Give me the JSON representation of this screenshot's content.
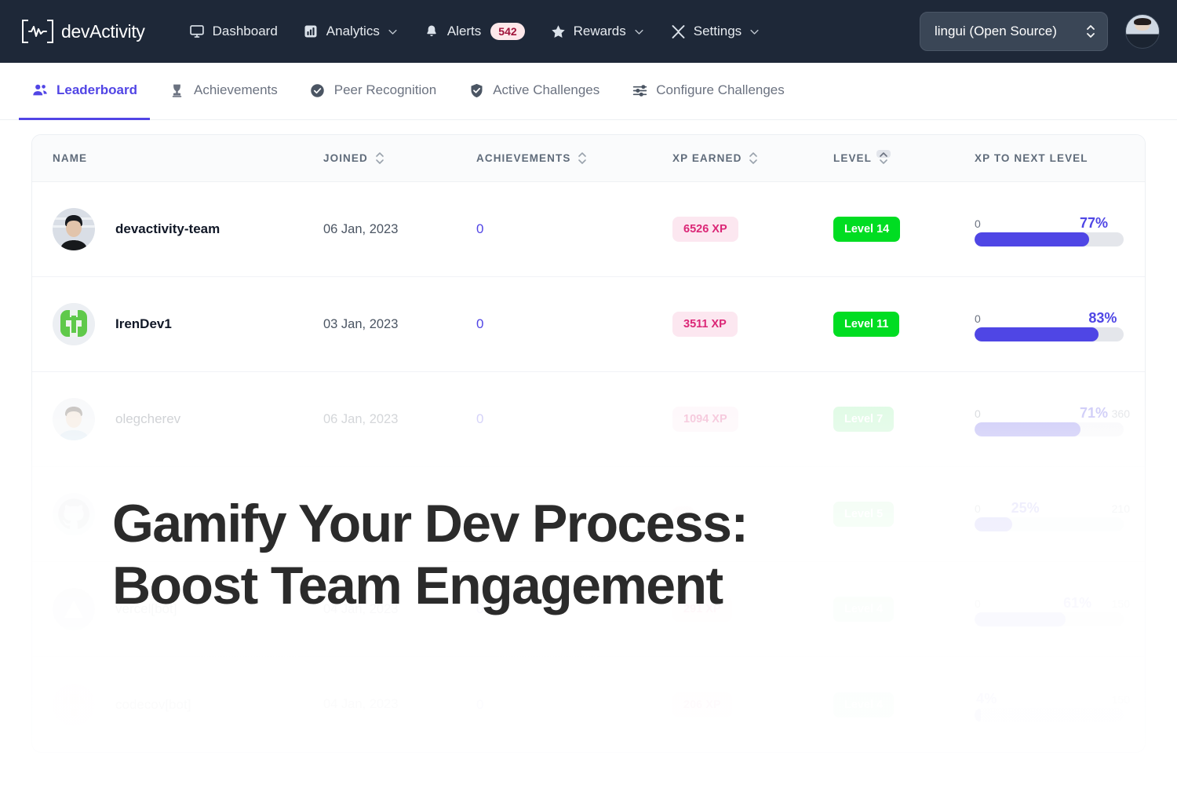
{
  "navbar": {
    "brand": "devActivity",
    "brand_icon": "waveform-bracket-logo",
    "items": [
      {
        "label": "Dashboard",
        "icon": "monitor-icon",
        "has_caret": false,
        "badge": null
      },
      {
        "label": "Analytics",
        "icon": "bar-chart-icon",
        "has_caret": true,
        "badge": null
      },
      {
        "label": "Alerts",
        "icon": "bell-icon",
        "has_caret": false,
        "badge": "542"
      },
      {
        "label": "Rewards",
        "icon": "star-icon",
        "has_caret": true,
        "badge": null
      },
      {
        "label": "Settings",
        "icon": "wrench-screwdriver-icon",
        "has_caret": true,
        "badge": null
      }
    ],
    "repo_select": {
      "value": "lingui (Open Source)",
      "icon": "up-down-chevron-icon"
    },
    "avatar": "user-avatar"
  },
  "tabs": [
    {
      "label": "Leaderboard",
      "icon": "people-icon",
      "active": true
    },
    {
      "label": "Achievements",
      "icon": "trophy-icon",
      "active": false
    },
    {
      "label": "Peer Recognition",
      "icon": "check-shield-icon",
      "active": false
    },
    {
      "label": "Active Challenges",
      "icon": "shield-check-icon",
      "active": false
    },
    {
      "label": "Configure Challenges",
      "icon": "sliders-icon",
      "active": false
    }
  ],
  "table": {
    "columns": [
      {
        "label": "NAME",
        "sortable": false
      },
      {
        "label": "JOINED",
        "sortable": true
      },
      {
        "label": "ACHIEVEMENTS",
        "sortable": true
      },
      {
        "label": "XP EARNED",
        "sortable": true
      },
      {
        "label": "LEVEL",
        "sortable": true,
        "sort_hover": "asc"
      },
      {
        "label": "XP TO NEXT LEVEL",
        "sortable": false
      }
    ],
    "rows": [
      {
        "name": "devactivity-team",
        "avatar": "photo-avatar-dark",
        "joined": "06 Jan, 2023",
        "achievements": "0",
        "xp_earned": "6526 XP",
        "level": "Level 14",
        "progress": {
          "min": "0",
          "max": "",
          "percent_label": "77%",
          "percent": 77
        },
        "fade": 0
      },
      {
        "name": "IrenDev1",
        "avatar": "green-square-logo",
        "joined": "03 Jan, 2023",
        "achievements": "0",
        "xp_earned": "3511 XP",
        "level": "Level 11",
        "progress": {
          "min": "0",
          "max": "",
          "percent_label": "83%",
          "percent": 83
        },
        "fade": 0
      },
      {
        "name": "olegcherev",
        "avatar": "photo-avatar-light",
        "joined": "06 Jan, 2023",
        "achievements": "0",
        "xp_earned": "1094 XP",
        "level": "Level 7",
        "progress": {
          "min": "0",
          "max": "360",
          "percent_label": "71%",
          "percent": 71
        },
        "fade": 1
      },
      {
        "name": "",
        "avatar": "github-icon",
        "joined": "",
        "achievements": "",
        "xp_earned": "",
        "level": "Level 5",
        "progress": {
          "min": "0",
          "max": "210",
          "percent_label": "25%",
          "percent": 25
        },
        "fade": 2
      },
      {
        "name": "vercel[bot]",
        "avatar": "vercel-triangle-icon",
        "joined": "04 Jan, 2023",
        "achievements": "0",
        "xp_earned": "291 XP",
        "level": "Level 4",
        "progress": {
          "min": "0",
          "max": "150",
          "percent_label": "61%",
          "percent": 61
        },
        "fade": 3
      },
      {
        "name": "codecov[bot]",
        "avatar": "codecov-umbrella-icon",
        "joined": "04 Jan, 2023",
        "achievements": "0",
        "xp_earned": "206 XP",
        "level": "Level 4",
        "progress": {
          "min": "",
          "max": "150",
          "percent_label": "4%",
          "percent": 4
        },
        "fade": 4
      }
    ]
  },
  "overlay": {
    "headline_line1": "Gamify Your Dev Process:",
    "headline_line2": "Boost Team Engagement"
  },
  "colors": {
    "navbar_bg": "#1e2838",
    "accent": "#5145e5",
    "progress_fill": "#4f46e5",
    "level_badge": "#00dd22",
    "xp_badge_bg": "#fce7f0",
    "xp_badge_text": "#db2777",
    "alert_badge_bg": "#fde8ea",
    "alert_badge_text": "#9f1239"
  }
}
